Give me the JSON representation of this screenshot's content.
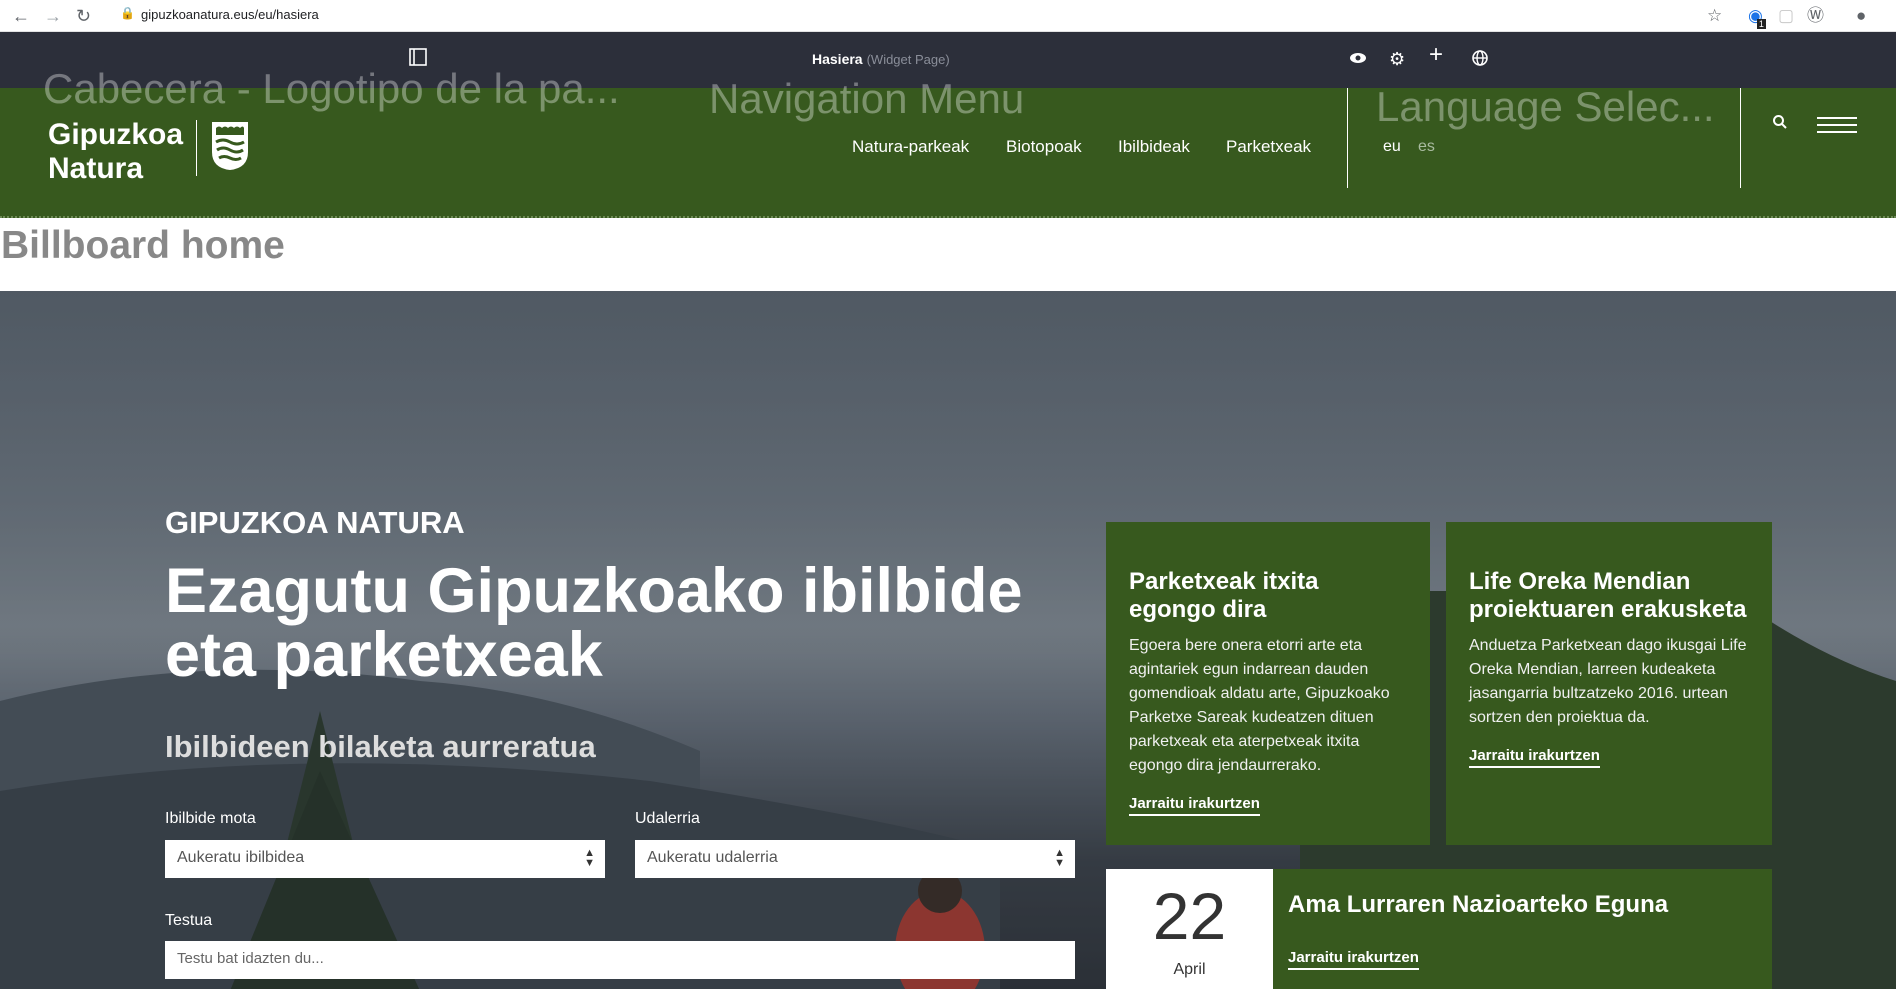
{
  "browser": {
    "url": "gipuzkoanatura.eus/eu/hasiera",
    "back_icon": "arrow-left-icon",
    "forward_icon": "arrow-right-icon",
    "reload_icon": "reload-icon",
    "lock_icon": "lock-icon",
    "extension_badge": "1"
  },
  "admin_bar": {
    "title": "Hasiera",
    "subtitle": "(Widget Page)"
  },
  "header": {
    "ghost_logo_label": "Cabecera - Logotipo de la pa...",
    "ghost_nav_label": "Navigation Menu",
    "ghost_lang_label": "Language Selec...",
    "logo_line1": "Gipuzkoa",
    "logo_line2": "Natura",
    "nav": [
      "Natura-parkeak",
      "Biotopoak",
      "Ibilbideak",
      "Parketxeak"
    ],
    "languages": [
      "eu",
      "es"
    ],
    "active_language": "eu",
    "colors": {
      "brand_green": "#37591e",
      "inactive_lang": "#a9bba0"
    }
  },
  "billboard_label": "Billboard home",
  "hero": {
    "eyebrow": "GIPUZKOA NATURA",
    "title": "Ezagutu Gipuzkoako ibilbide eta parketxeak",
    "search_heading": "Ibilbideen bilaketa aurreratua",
    "route_type_label": "Ibilbide mota",
    "route_type_value": "Aukeratu ibilbidea",
    "municipality_label": "Udalerria",
    "municipality_value": "Aukeratu udalerria",
    "text_label": "Testua",
    "text_placeholder": "Testu bat idazten du..."
  },
  "cards": [
    {
      "title": "Parketxeak itxita egongo dira",
      "body": "Egoera bere onera etorri arte eta agintariek egun indarrean dauden gomendioak aldatu arte, Gipuzkoako Parketxe Sareak kudeatzen dituen parketxeak eta aterpetxeak itxita egongo dira jendaurrerako.",
      "link": "Jarraitu irakurtzen"
    },
    {
      "title": "Life Oreka Mendian proiektuaren erakusketa",
      "body": "Anduetza Parketxean dago ikusgai Life Oreka Mendian, larreen kudeaketa jasangarria bultzatzeko 2016. urtean sortzen den proiektua da.",
      "link": "Jarraitu irakurtzen"
    }
  ],
  "event": {
    "day": "22",
    "month": "April",
    "title": "Ama Lurraren Nazioarteko Eguna",
    "link": "Jarraitu irakurtzen"
  }
}
